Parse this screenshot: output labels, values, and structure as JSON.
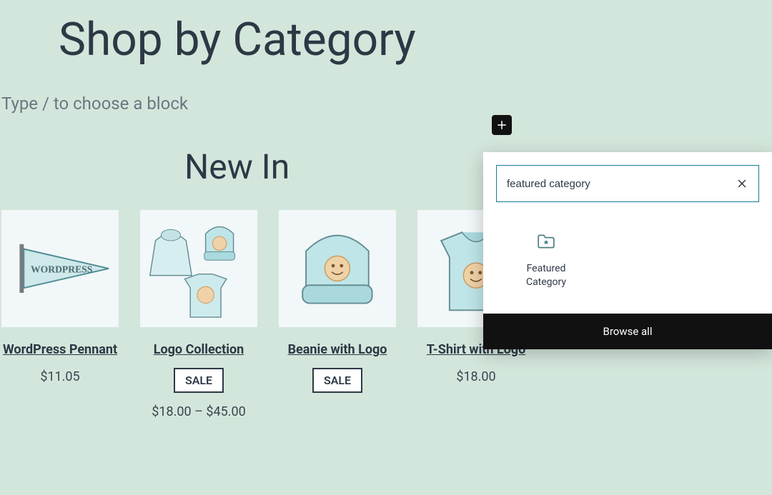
{
  "page_title": "Shop by Category",
  "placeholder_hint": "Type / to choose a block",
  "section_title": "New In",
  "products": [
    {
      "name": "WordPress Pennant",
      "price": "$11.05",
      "sale": false
    },
    {
      "name": "Logo Collection",
      "price": "$18.00 – $45.00",
      "sale": true
    },
    {
      "name": "Beanie with Logo",
      "price": "",
      "sale": true
    },
    {
      "name": "T-Shirt with Logo",
      "price": "$18.00",
      "sale": false
    }
  ],
  "sale_label": "SALE",
  "block_inserter": {
    "search_value": "featured category",
    "result_label": "Featured Category",
    "browse_all_label": "Browse all"
  }
}
